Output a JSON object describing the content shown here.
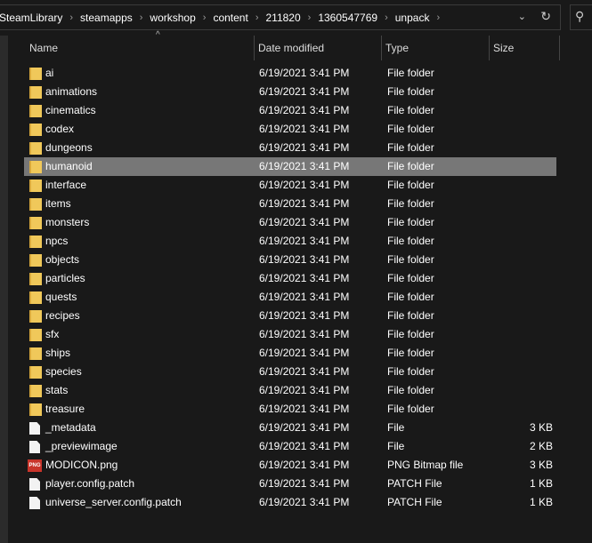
{
  "breadcrumb": [
    "SteamLibrary",
    "steamapps",
    "workshop",
    "content",
    "211820",
    "1360547769",
    "unpack"
  ],
  "columns": {
    "name": "Name",
    "date": "Date modified",
    "type": "Type",
    "size": "Size"
  },
  "files": [
    {
      "name": "ai",
      "date": "6/19/2021 3:41 PM",
      "type": "File folder",
      "size": "",
      "icon": "folder"
    },
    {
      "name": "animations",
      "date": "6/19/2021 3:41 PM",
      "type": "File folder",
      "size": "",
      "icon": "folder"
    },
    {
      "name": "cinematics",
      "date": "6/19/2021 3:41 PM",
      "type": "File folder",
      "size": "",
      "icon": "folder"
    },
    {
      "name": "codex",
      "date": "6/19/2021 3:41 PM",
      "type": "File folder",
      "size": "",
      "icon": "folder"
    },
    {
      "name": "dungeons",
      "date": "6/19/2021 3:41 PM",
      "type": "File folder",
      "size": "",
      "icon": "folder"
    },
    {
      "name": "humanoid",
      "date": "6/19/2021 3:41 PM",
      "type": "File folder",
      "size": "",
      "icon": "folder",
      "selected": true
    },
    {
      "name": "interface",
      "date": "6/19/2021 3:41 PM",
      "type": "File folder",
      "size": "",
      "icon": "folder"
    },
    {
      "name": "items",
      "date": "6/19/2021 3:41 PM",
      "type": "File folder",
      "size": "",
      "icon": "folder"
    },
    {
      "name": "monsters",
      "date": "6/19/2021 3:41 PM",
      "type": "File folder",
      "size": "",
      "icon": "folder"
    },
    {
      "name": "npcs",
      "date": "6/19/2021 3:41 PM",
      "type": "File folder",
      "size": "",
      "icon": "folder"
    },
    {
      "name": "objects",
      "date": "6/19/2021 3:41 PM",
      "type": "File folder",
      "size": "",
      "icon": "folder"
    },
    {
      "name": "particles",
      "date": "6/19/2021 3:41 PM",
      "type": "File folder",
      "size": "",
      "icon": "folder"
    },
    {
      "name": "quests",
      "date": "6/19/2021 3:41 PM",
      "type": "File folder",
      "size": "",
      "icon": "folder"
    },
    {
      "name": "recipes",
      "date": "6/19/2021 3:41 PM",
      "type": "File folder",
      "size": "",
      "icon": "folder"
    },
    {
      "name": "sfx",
      "date": "6/19/2021 3:41 PM",
      "type": "File folder",
      "size": "",
      "icon": "folder"
    },
    {
      "name": "ships",
      "date": "6/19/2021 3:41 PM",
      "type": "File folder",
      "size": "",
      "icon": "folder"
    },
    {
      "name": "species",
      "date": "6/19/2021 3:41 PM",
      "type": "File folder",
      "size": "",
      "icon": "folder"
    },
    {
      "name": "stats",
      "date": "6/19/2021 3:41 PM",
      "type": "File folder",
      "size": "",
      "icon": "folder"
    },
    {
      "name": "treasure",
      "date": "6/19/2021 3:41 PM",
      "type": "File folder",
      "size": "",
      "icon": "folder"
    },
    {
      "name": "_metadata",
      "date": "6/19/2021 3:41 PM",
      "type": "File",
      "size": "3 KB",
      "icon": "file"
    },
    {
      "name": "_previewimage",
      "date": "6/19/2021 3:41 PM",
      "type": "File",
      "size": "2 KB",
      "icon": "file"
    },
    {
      "name": "MODICON.png",
      "date": "6/19/2021 3:41 PM",
      "type": "PNG Bitmap file",
      "size": "3 KB",
      "icon": "png"
    },
    {
      "name": "player.config.patch",
      "date": "6/19/2021 3:41 PM",
      "type": "PATCH File",
      "size": "1 KB",
      "icon": "file"
    },
    {
      "name": "universe_server.config.patch",
      "date": "6/19/2021 3:41 PM",
      "type": "PATCH File",
      "size": "1 KB",
      "icon": "file"
    }
  ],
  "png_icon_label": "PNG"
}
